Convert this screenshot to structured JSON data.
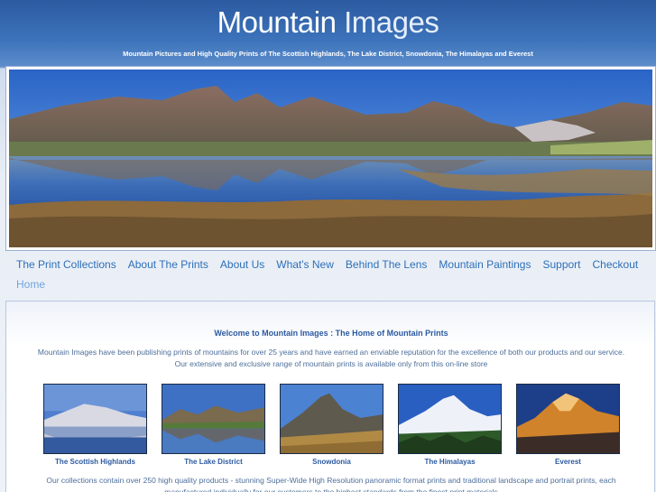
{
  "header": {
    "title_part1": "Mountain",
    "title_part2": "Images",
    "tagline": "Mountain Pictures and High Quality Prints of The Scottish Highlands, The Lake District, Snowdonia, The Himalayas and Everest"
  },
  "nav": {
    "items": [
      "The Print Collections",
      "About The Prints",
      "About Us",
      "What's New",
      "Behind The Lens",
      "Mountain Paintings",
      "Support",
      "Checkout"
    ],
    "home": "Home"
  },
  "main": {
    "welcome": "Welcome to Mountain Images : The Home of Mountain Prints",
    "intro": "Mountain Images have been publishing prints of mountains for over 25 years and have earned an enviable reputation for the excellence of both our products and our service. Our extensive and exclusive range of mountain prints is available only from this on-line store",
    "collections": [
      {
        "label": "The Scottish Highlands"
      },
      {
        "label": "The Lake District"
      },
      {
        "label": "Snowdonia"
      },
      {
        "label": "The Himalayas"
      },
      {
        "label": "Everest"
      }
    ],
    "outro": "Our collections contain over 250 high quality products - stunning Super-Wide High Resolution panoramic format prints and traditional landscape and portrait prints, each manufactured individually for our customers to the highest standards from the finest print materials"
  },
  "colors": {
    "header_blue": "#2c5aa0",
    "link_blue": "#2d6fb8",
    "text_blue": "#4d6f9b"
  }
}
